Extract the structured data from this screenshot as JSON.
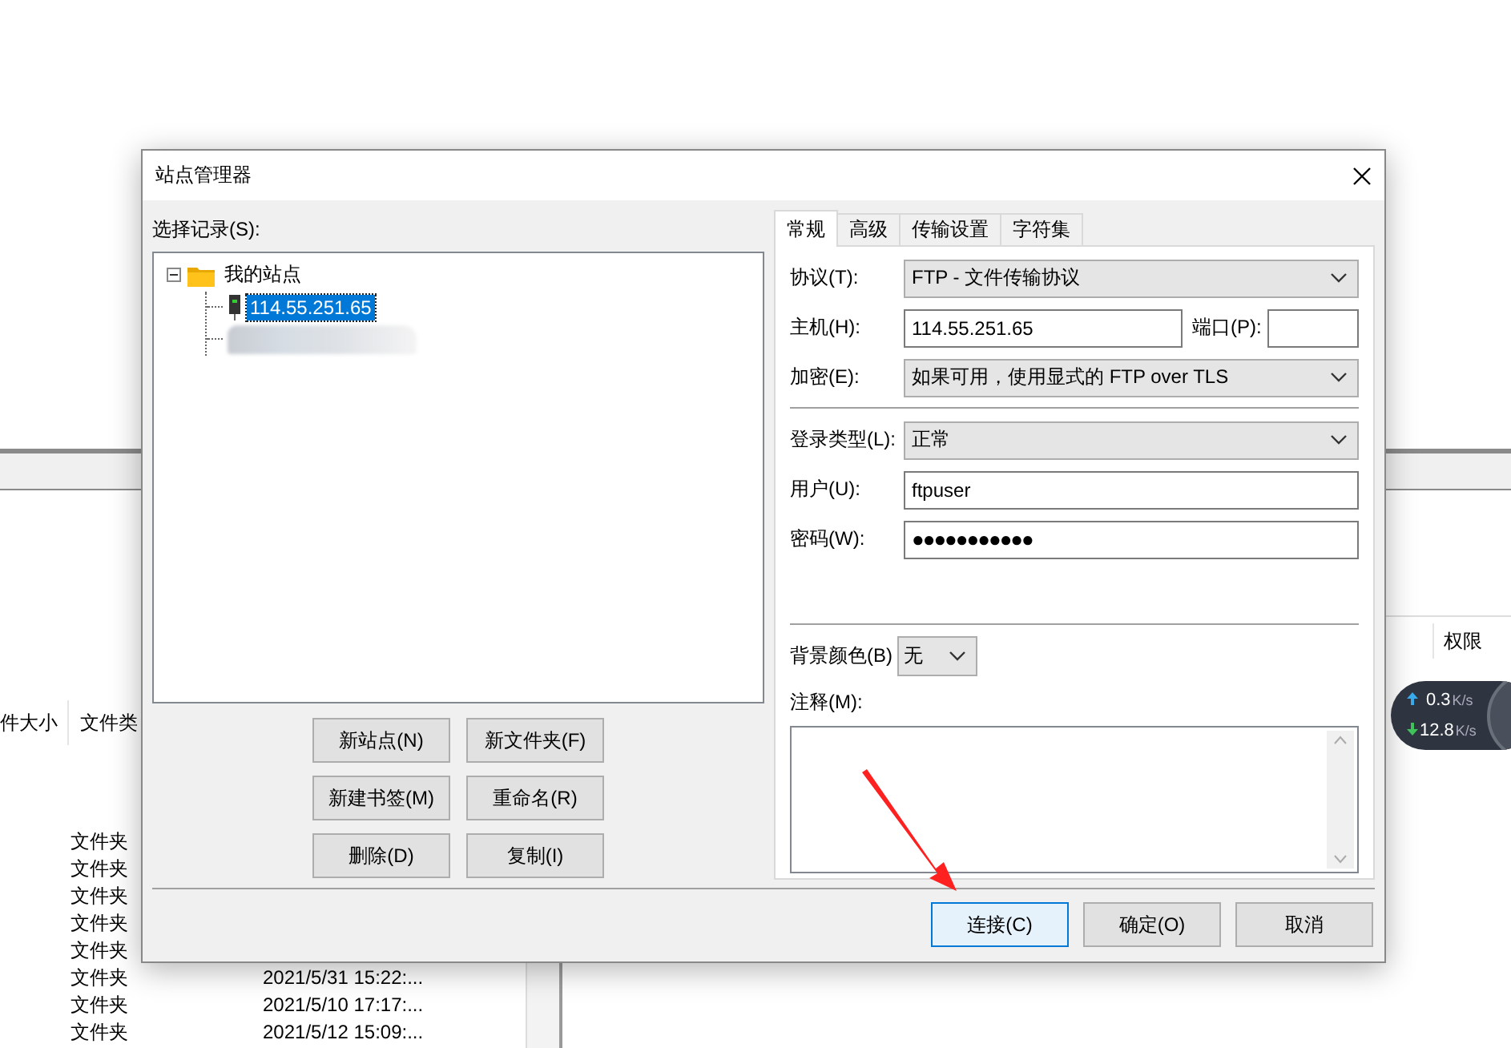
{
  "background_window": {
    "file_columns": [
      "件大小",
      "文件类"
    ],
    "file_rows": [
      {
        "type": "文件夹"
      },
      {
        "type": "文件夹"
      },
      {
        "type": "文件夹"
      },
      {
        "type": "文件夹"
      },
      {
        "type": "文件夹"
      },
      {
        "type": "文件夹",
        "modified": "2021/5/31 15:22:..."
      },
      {
        "type": "文件夹",
        "modified": "2021/5/10 17:17:..."
      },
      {
        "type": "文件夹",
        "modified": "2021/5/12 15:09:..."
      }
    ],
    "remote_columns": [
      "权限"
    ],
    "speed": {
      "upload": "0.3",
      "upload_unit": "K/s",
      "download": "12.8",
      "download_unit": "K/s"
    }
  },
  "dialog": {
    "title": "站点管理器",
    "tree_label": "选择记录(S):",
    "tree": [
      {
        "kind": "folder",
        "label": "我的站点",
        "expanded": true,
        "selected": false,
        "children": [
          {
            "kind": "site",
            "label": "114.55.251.65",
            "selected": true
          },
          {
            "kind": "redacted",
            "selected": false
          }
        ]
      }
    ],
    "site_buttons": [
      "新站点(N)",
      "新文件夹(F)",
      "新建书签(M)",
      "重命名(R)",
      "删除(D)",
      "复制(I)"
    ],
    "tabs": [
      {
        "label": "常规",
        "selected": true
      },
      {
        "label": "高级",
        "selected": false
      },
      {
        "label": "传输设置",
        "selected": false
      },
      {
        "label": "字符集",
        "selected": false
      }
    ],
    "connection_fields": [
      {
        "kind": "select",
        "label": "协议(T):",
        "value": "FTP - 文件传输协议"
      },
      {
        "kind": "host",
        "label": "主机(H):",
        "value": "114.55.251.65",
        "port_label": "端口(P):"
      },
      {
        "kind": "select",
        "label": "加密(E):",
        "value": "如果可用，使用显式的 FTP over TLS"
      }
    ],
    "login_fields": [
      {
        "kind": "select",
        "label": "登录类型(L):",
        "value": "正常"
      },
      {
        "kind": "text",
        "label": "用户(U):",
        "value": "ftpuser"
      },
      {
        "kind": "password",
        "label": "密码(W):",
        "value": "●●●●●●●●●●●"
      }
    ],
    "background_color": {
      "label": "背景颜色(B)",
      "value": "无"
    },
    "comments": {
      "label": "注释(M):"
    },
    "footer_buttons": [
      {
        "label": "连接(C)",
        "focused": true
      },
      {
        "label": "确定(O)",
        "focused": false
      },
      {
        "label": "取消",
        "focused": false
      }
    ]
  }
}
